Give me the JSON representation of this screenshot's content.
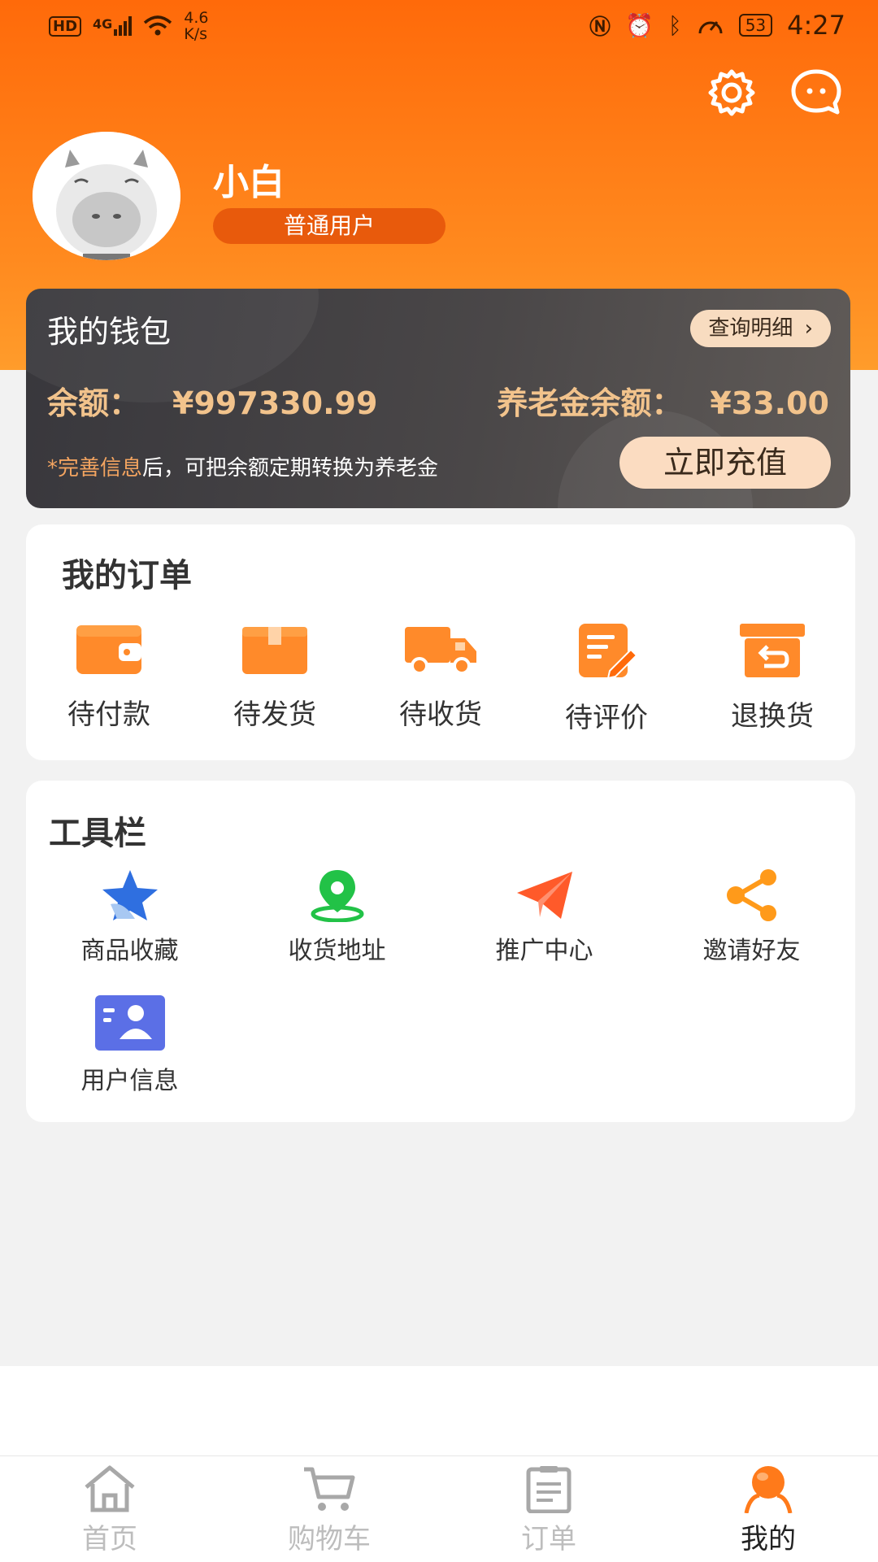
{
  "status_bar": {
    "hd": "HD",
    "network": "4G",
    "speed_value": "4.6",
    "speed_unit": "K/s",
    "battery": "53",
    "time": "4:27"
  },
  "header": {
    "settings_icon": "gear-icon",
    "message_icon": "message-icon"
  },
  "profile": {
    "name": "小白",
    "user_type": "普通用户"
  },
  "wallet": {
    "title": "我的钱包",
    "detail_button": "查询明细",
    "balance_label": "余额：",
    "balance_value": "¥997330.99",
    "pension_label": "养老金余额：",
    "pension_value": "¥33.00",
    "hint_prefix": "*",
    "hint_highlight": "完善信息",
    "hint_rest": "后，可把余额定期转换为养老金",
    "recharge_button": "立即充值"
  },
  "orders": {
    "title": "我的订单",
    "items": [
      {
        "label": "待付款",
        "icon": "wallet-icon"
      },
      {
        "label": "待发货",
        "icon": "package-icon"
      },
      {
        "label": "待收货",
        "icon": "truck-icon"
      },
      {
        "label": "待评价",
        "icon": "review-icon"
      },
      {
        "label": "退换货",
        "icon": "return-icon"
      }
    ]
  },
  "tools": {
    "title": "工具栏",
    "items": [
      {
        "label": "商品收藏",
        "icon": "star-icon"
      },
      {
        "label": "收货地址",
        "icon": "location-icon"
      },
      {
        "label": "推广中心",
        "icon": "paper-plane-icon"
      },
      {
        "label": "邀请好友",
        "icon": "share-icon"
      },
      {
        "label": "用户信息",
        "icon": "id-card-icon"
      }
    ]
  },
  "tabbar": {
    "items": [
      {
        "label": "首页",
        "icon": "home-icon"
      },
      {
        "label": "购物车",
        "icon": "cart-icon"
      },
      {
        "label": "订单",
        "icon": "order-list-icon"
      },
      {
        "label": "我的",
        "icon": "profile-icon",
        "active": true
      }
    ]
  },
  "colors": {
    "brand_orange": "#ff6a0a",
    "gold_text": "#f2c38c",
    "wallet_dark": "#3c3b40"
  }
}
